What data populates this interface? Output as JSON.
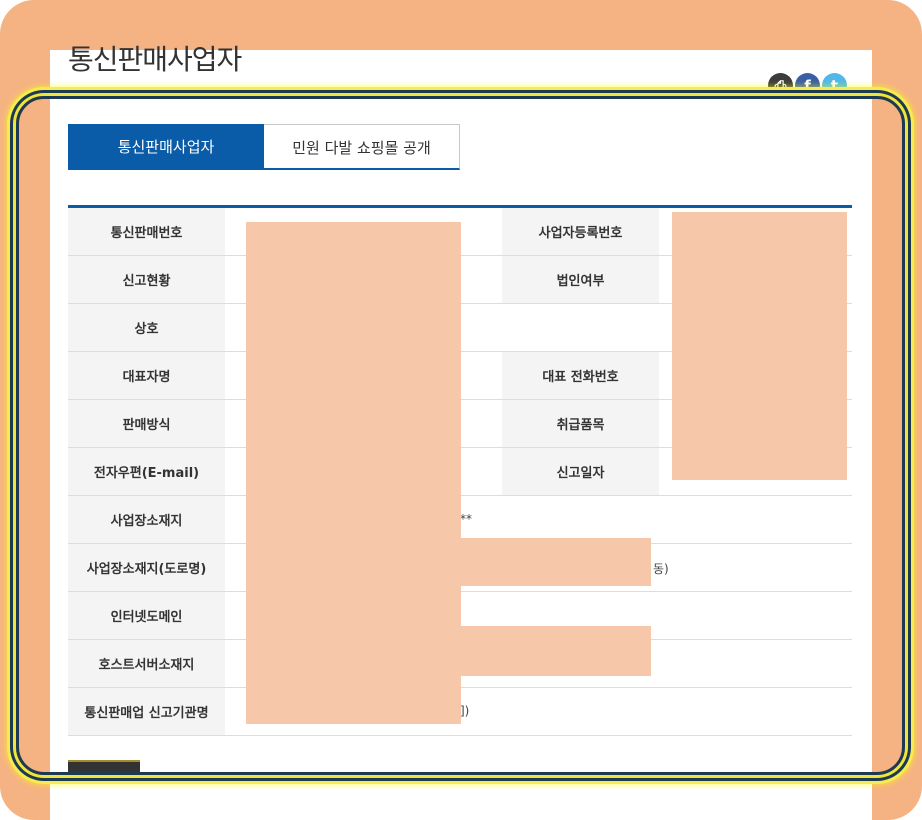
{
  "page": {
    "title": "통신판매사업자"
  },
  "share": {
    "print_icon": "printer-icon",
    "facebook_icon": "facebook-icon",
    "facebook_glyph": "f",
    "twitter_icon": "twitter-icon",
    "twitter_glyph": "t"
  },
  "tabs": [
    {
      "label": "통신판매사업자",
      "active": true
    },
    {
      "label": "민원 다발 쇼핑몰 공개",
      "active": false
    }
  ],
  "table": {
    "rows": [
      {
        "label": "통신판매번호",
        "label2": "사업자등록번호"
      },
      {
        "label": "신고현황",
        "label2": "법인여부"
      },
      {
        "label": "상호"
      },
      {
        "label": "대표자명",
        "label2": "대표 전화번호"
      },
      {
        "label": "판매방식",
        "label2": "취급품목"
      },
      {
        "label": "전자우편(E-mail)",
        "label2": "신고일자"
      },
      {
        "label": "사업장소재지",
        "value_fragment": "**"
      },
      {
        "label": "사업장소재지(도로명)",
        "value_fragment": "동)"
      },
      {
        "label": "인터넷도메인"
      },
      {
        "label": "호스트서버소재지"
      },
      {
        "label": "통신판매업 신고기관명",
        "value_fragment": "])"
      }
    ]
  },
  "colors": {
    "accent": "#0a5ba8",
    "frame": "#f5b384",
    "redaction": "#f6c8a9",
    "highlight": "#f0e63a"
  }
}
